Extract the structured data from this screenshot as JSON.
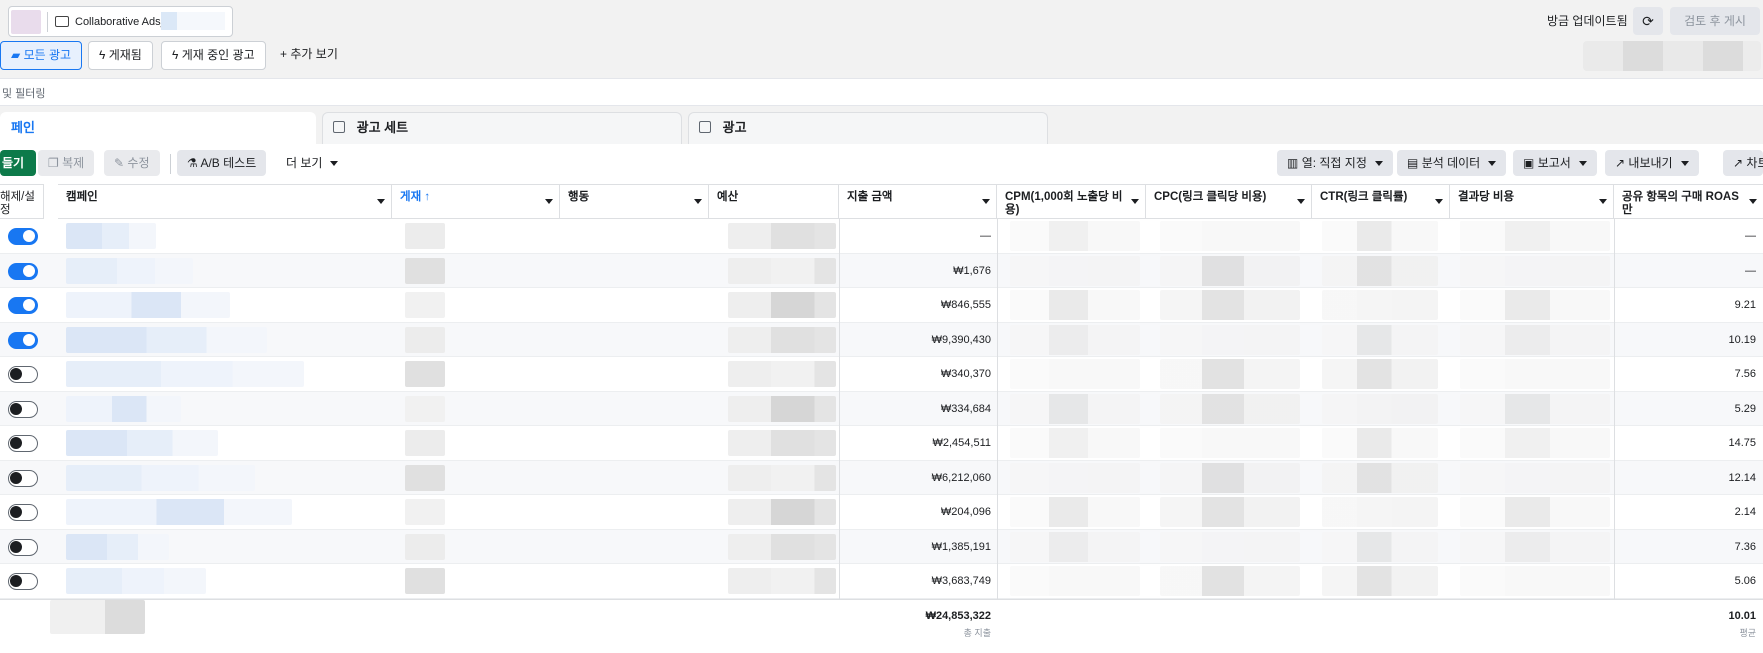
{
  "header": {
    "account_name": "Collaborative Ads_",
    "updated_text": "방금 업데이트됨",
    "review_button": "검토 후 게시"
  },
  "views": {
    "all_ads": "모든 광고",
    "published": "게재됨",
    "active_ads": "게재 중인 광고",
    "more": "추가 보기"
  },
  "filter_text": "및 필터링",
  "tabs": {
    "campaigns": "페인",
    "adsets": "광고 세트",
    "ads": "광고"
  },
  "toolbar": {
    "create": "들기",
    "duplicate": "복제",
    "edit": "수정",
    "ab_test": "A/B 테스트",
    "more": "더 보기",
    "columns": "열: 직접 지정",
    "breakdown": "분석 데이터",
    "reports": "보고서",
    "export": "내보내기",
    "chart": "차트"
  },
  "columns": {
    "toggle": "해제/설정",
    "campaign": "캠페인",
    "delivery": "게재 ↑",
    "actions": "행동",
    "budget": "예산",
    "spend": "지출 금액",
    "cpm": "CPM(1,000회 노출당 비용)",
    "cpc": "CPC(링크 클릭당 비용)",
    "ctr": "CTR(링크 클릭률)",
    "cost_per_result": "결과당 비용",
    "roas": "공유 항목의 구매 ROAS만"
  },
  "rows": [
    {
      "on": true,
      "spend": "—",
      "roas": "—"
    },
    {
      "on": true,
      "spend": "₩1,676",
      "roas": "—"
    },
    {
      "on": true,
      "spend": "₩846,555",
      "roas": "9.21"
    },
    {
      "on": true,
      "spend": "₩9,390,430",
      "roas": "10.19"
    },
    {
      "on": false,
      "spend": "₩340,370",
      "roas": "7.56"
    },
    {
      "on": false,
      "spend": "₩334,684",
      "roas": "5.29"
    },
    {
      "on": false,
      "spend": "₩2,454,511",
      "roas": "14.75"
    },
    {
      "on": false,
      "spend": "₩6,212,060",
      "roas": "12.14"
    },
    {
      "on": false,
      "spend": "₩204,096",
      "roas": "2.14"
    },
    {
      "on": false,
      "spend": "₩1,385,191",
      "roas": "7.36"
    },
    {
      "on": false,
      "spend": "₩3,683,749",
      "roas": "5.06"
    }
  ],
  "totals": {
    "spend": "₩24,853,322",
    "spend_label": "총 지출",
    "roas": "10.01",
    "roas_label": "평균"
  }
}
